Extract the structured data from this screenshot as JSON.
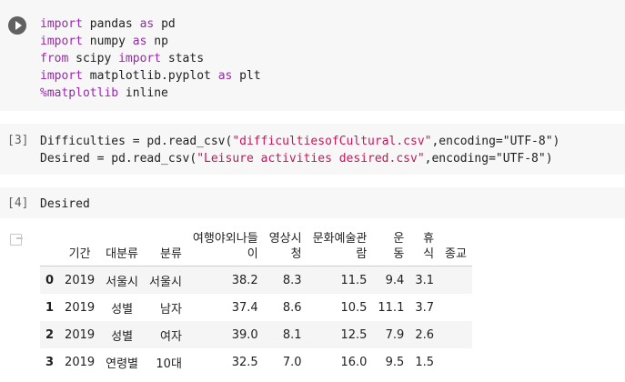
{
  "cells": [
    {
      "code_lines": [
        [
          {
            "t": "import",
            "c": "kw"
          },
          {
            "t": " pandas "
          },
          {
            "t": "as",
            "c": "kw"
          },
          {
            "t": " pd"
          }
        ],
        [
          {
            "t": "import",
            "c": "kw"
          },
          {
            "t": " numpy "
          },
          {
            "t": "as",
            "c": "kw"
          },
          {
            "t": " np"
          }
        ],
        [
          {
            "t": "from",
            "c": "kw"
          },
          {
            "t": " scipy "
          },
          {
            "t": "import",
            "c": "kw"
          },
          {
            "t": " stats"
          }
        ],
        [
          {
            "t": "import",
            "c": "kw"
          },
          {
            "t": " matplotlib.pyplot "
          },
          {
            "t": "as",
            "c": "kw"
          },
          {
            "t": " plt"
          }
        ],
        [
          {
            "t": "%matplotlib",
            "c": "kw"
          },
          {
            "t": " inline"
          }
        ]
      ]
    },
    {
      "prompt": "[3]",
      "code_lines": [
        [
          {
            "t": "Difficulties = pd.read_csv("
          },
          {
            "t": "\"difficultiesofCultural.csv\"",
            "c": "str"
          },
          {
            "t": ",encoding=\"UTF-8\")"
          }
        ],
        [
          {
            "t": "Desired = pd.read_csv("
          },
          {
            "t": "\"Leisure activities desired.csv\"",
            "c": "str"
          },
          {
            "t": ",encoding=\"UTF-8\")"
          }
        ]
      ]
    },
    {
      "prompt": "[4]",
      "code_lines": [
        [
          {
            "t": "Desired"
          }
        ]
      ]
    }
  ],
  "table": {
    "columns": [
      "",
      "기간",
      "대분류",
      "분류",
      "여행야외나들\n이",
      "영상시\n청",
      "문화예술관\n람",
      "운\n동",
      "휴\n식",
      "종교"
    ],
    "rows": [
      [
        "0",
        "2019",
        "서울시",
        "서울시",
        "38.2",
        "8.3",
        "11.5",
        "9.4",
        "3.1",
        ""
      ],
      [
        "1",
        "2019",
        "성별",
        "남자",
        "37.4",
        "8.6",
        "10.5",
        "11.1",
        "3.7",
        ""
      ],
      [
        "2",
        "2019",
        "성별",
        "여자",
        "39.0",
        "8.1",
        "12.5",
        "7.9",
        "2.6",
        ""
      ],
      [
        "3",
        "2019",
        "연령별",
        "10대",
        "32.5",
        "7.0",
        "16.0",
        "9.5",
        "1.5",
        ""
      ]
    ]
  },
  "icons": {
    "run": "play-icon",
    "output": "output-icon"
  },
  "colors": {
    "cell_bg": "#f7f7f7",
    "keyword": "#9c27b0",
    "string": "#c2185b",
    "stripe": "#f5f5f5"
  }
}
